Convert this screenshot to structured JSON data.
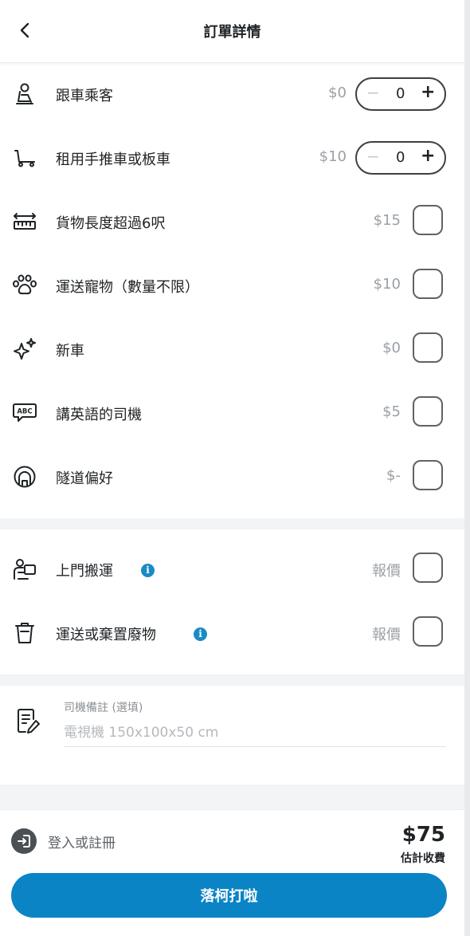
{
  "header": {
    "title": "訂單詳情"
  },
  "options": [
    {
      "id": "passenger",
      "label": "跟車乘客",
      "price": "$0",
      "control": "stepper",
      "count": "0"
    },
    {
      "id": "trolley",
      "label": "租用手推車或板車",
      "price": "$10",
      "control": "stepper",
      "count": "0"
    },
    {
      "id": "long-goods",
      "label": "貨物長度超過6呎",
      "price": "$15",
      "control": "checkbox"
    },
    {
      "id": "pets",
      "label": "運送寵物（數量不限）",
      "price": "$10",
      "control": "checkbox"
    },
    {
      "id": "new-car",
      "label": "新車",
      "price": "$0",
      "control": "checkbox"
    },
    {
      "id": "english",
      "label": "講英語的司機",
      "price": "$5",
      "control": "checkbox"
    },
    {
      "id": "tunnel",
      "label": "隧道偏好",
      "price": "$-",
      "control": "checkbox"
    }
  ],
  "services": [
    {
      "id": "door-moving",
      "label": "上門搬運",
      "price": "報價",
      "has_info": true,
      "control": "checkbox"
    },
    {
      "id": "waste",
      "label": "運送或棄置廢物",
      "price": "報價",
      "has_info": true,
      "control": "checkbox"
    }
  ],
  "notes": {
    "label": "司機備註 (選填)",
    "placeholder": "電視機 150x100x50 cm"
  },
  "footer": {
    "login_label": "登入或註冊",
    "total": "$75",
    "total_label": "估計收費",
    "cta_label": "落柯打啦"
  },
  "stepper": {
    "minus": "−",
    "plus": "+"
  },
  "colors": {
    "accent": "#0b84c6",
    "info": "#1b8bc4",
    "muted": "#9ba0a6"
  }
}
